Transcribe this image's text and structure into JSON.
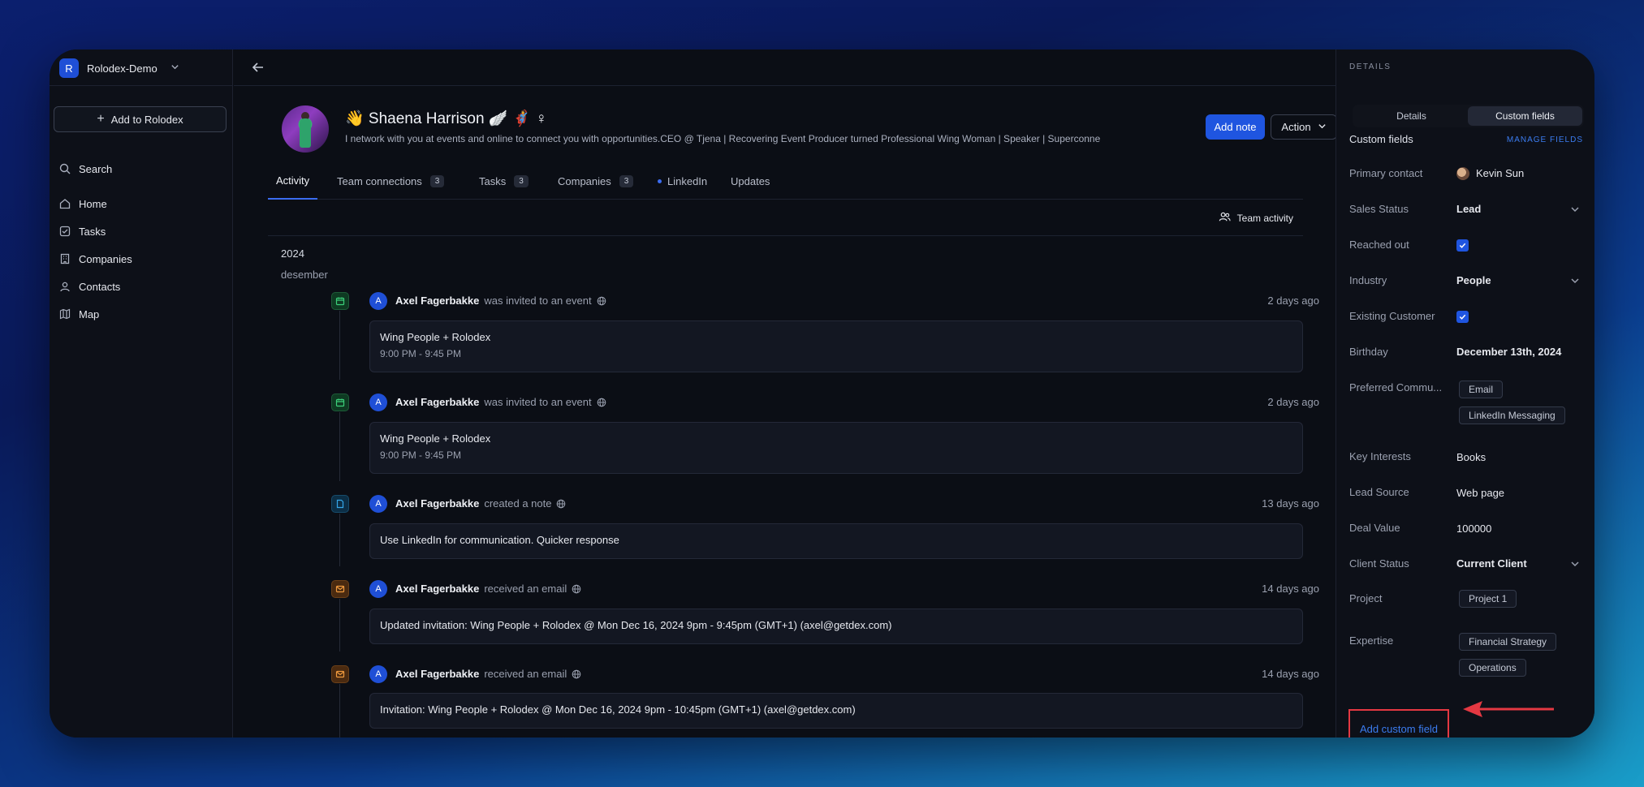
{
  "workspace": {
    "badge": "R",
    "name": "Rolodex-Demo"
  },
  "sidebar": {
    "add_label": "Add to Rolodex",
    "search_label": "Search",
    "items": [
      {
        "label": "Home",
        "icon": "home-icon"
      },
      {
        "label": "Tasks",
        "icon": "tasks-icon"
      },
      {
        "label": "Companies",
        "icon": "companies-icon"
      },
      {
        "label": "Contacts",
        "icon": "contacts-icon"
      },
      {
        "label": "Map",
        "icon": "map-icon"
      }
    ]
  },
  "profile": {
    "name": "👋 Shaena Harrison 🪽 🦸‍♀️ ♀",
    "bio": "I network with you at events and online to connect you with opportunities.CEO @ Tjena | Recovering Event Producer turned Professional Wing Woman | Speaker | Superconne",
    "add_note": "Add note",
    "action": "Action"
  },
  "tabs": [
    {
      "label": "Activity"
    },
    {
      "label": "Team connections",
      "count": "3"
    },
    {
      "label": "Tasks",
      "count": "3"
    },
    {
      "label": "Companies",
      "count": "3"
    },
    {
      "label": "LinkedIn"
    },
    {
      "label": "Updates"
    }
  ],
  "team_activity": "Team activity",
  "feed": {
    "year": "2024",
    "month": "desember",
    "events": [
      {
        "user_initial": "A",
        "user": "Axel Fagerbakke",
        "verb": "was invited to an event",
        "time": "2 days ago",
        "type": "calendar",
        "title": "Wing People + Rolodex",
        "sub": "9:00 PM - 9:45 PM"
      },
      {
        "user_initial": "A",
        "user": "Axel Fagerbakke",
        "verb": "was invited to an event",
        "time": "2 days ago",
        "type": "calendar",
        "title": "Wing People + Rolodex",
        "sub": "9:00 PM - 9:45 PM"
      },
      {
        "user_initial": "A",
        "user": "Axel Fagerbakke",
        "verb": "created a note",
        "time": "13 days ago",
        "type": "note",
        "title": "Use LinkedIn for communication. Quicker response"
      },
      {
        "user_initial": "A",
        "user": "Axel Fagerbakke",
        "verb": "received an email",
        "time": "14 days ago",
        "type": "email",
        "title": "Updated invitation: Wing People + Rolodex @ Mon Dec 16, 2024 9pm - 9:45pm (GMT+1) (axel@getdex.com)"
      },
      {
        "user_initial": "A",
        "user": "Axel Fagerbakke",
        "verb": "received an email",
        "time": "14 days ago",
        "type": "email",
        "title": "Invitation: Wing People + Rolodex @ Mon Dec 16, 2024 9pm - 10:45pm (GMT+1) (axel@getdex.com)"
      }
    ]
  },
  "details": {
    "header": "DETAILS",
    "seg_details": "Details",
    "seg_custom": "Custom fields",
    "cf_title": "Custom fields",
    "manage": "MANAGE FIELDS",
    "fields": {
      "primary_contact": {
        "label": "Primary contact",
        "value": "Kevin Sun"
      },
      "sales_status": {
        "label": "Sales Status",
        "value": "Lead"
      },
      "reached_out": {
        "label": "Reached out",
        "checked": true
      },
      "industry": {
        "label": "Industry",
        "value": "People"
      },
      "existing_customer": {
        "label": "Existing Customer",
        "checked": true
      },
      "birthday": {
        "label": "Birthday",
        "value": "December 13th, 2024"
      },
      "preferred_comm": {
        "label": "Preferred Commu...",
        "chips": [
          "Email",
          "LinkedIn Messaging"
        ]
      },
      "key_interests": {
        "label": "Key Interests",
        "value": "Books"
      },
      "lead_source": {
        "label": "Lead Source",
        "value": "Web page"
      },
      "deal_value": {
        "label": "Deal Value",
        "value": "100000"
      },
      "client_status": {
        "label": "Client Status",
        "value": "Current Client"
      },
      "project": {
        "label": "Project",
        "chips": [
          "Project 1"
        ]
      },
      "expertise": {
        "label": "Expertise",
        "chips": [
          "Financial Strategy",
          "Operations"
        ]
      }
    },
    "add_custom_field": "Add custom field"
  },
  "colors": {
    "accent": "#1f55e0",
    "highlight": "#e43842"
  }
}
